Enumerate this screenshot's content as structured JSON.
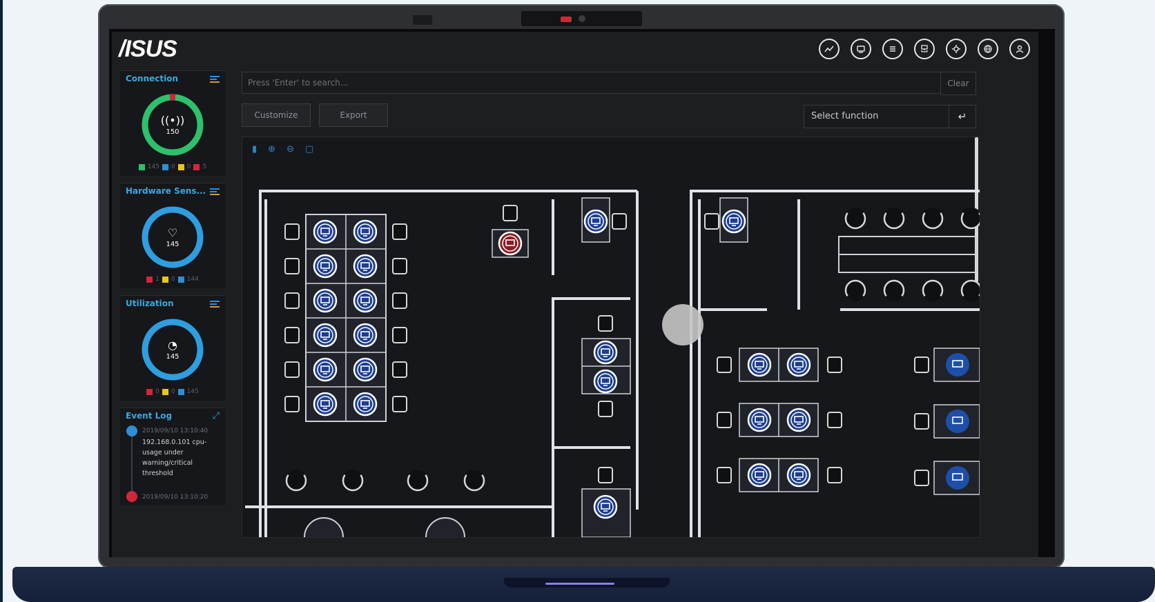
{
  "brand": {
    "logo_text": "/ISUS"
  },
  "top_icons": [
    "chart-icon",
    "device-icon",
    "list-icon",
    "network-icon",
    "settings-icon",
    "globe-icon",
    "user-icon"
  ],
  "search": {
    "placeholder": "Press 'Enter' to search...",
    "clear_label": "Clear"
  },
  "toolbar": {
    "customize_label": "Customize",
    "export_label": "Export",
    "select_function_label": "Select function"
  },
  "sidebar": {
    "connection": {
      "title": "Connection",
      "value": "150",
      "legend": [
        "145",
        "0",
        "0",
        "5"
      ]
    },
    "hardware": {
      "title": "Hardware Sens...",
      "value": "145",
      "legend": [
        "1",
        "0",
        "144"
      ]
    },
    "utilization": {
      "title": "Utilization",
      "value": "145",
      "legend": [
        "0",
        "0",
        "145"
      ]
    },
    "event_log": {
      "title": "Event Log",
      "first_time": "2019/09/10 13:10:40",
      "first_text": "192.168.0.101 cpu-usage under warning/critical threshold",
      "second_time": "2019/09/10 13:10:20"
    }
  },
  "colors": {
    "accent": "#2f8fd6",
    "alert": "#d3263a",
    "ok": "#2ec06b",
    "warn": "#e8c61c"
  }
}
